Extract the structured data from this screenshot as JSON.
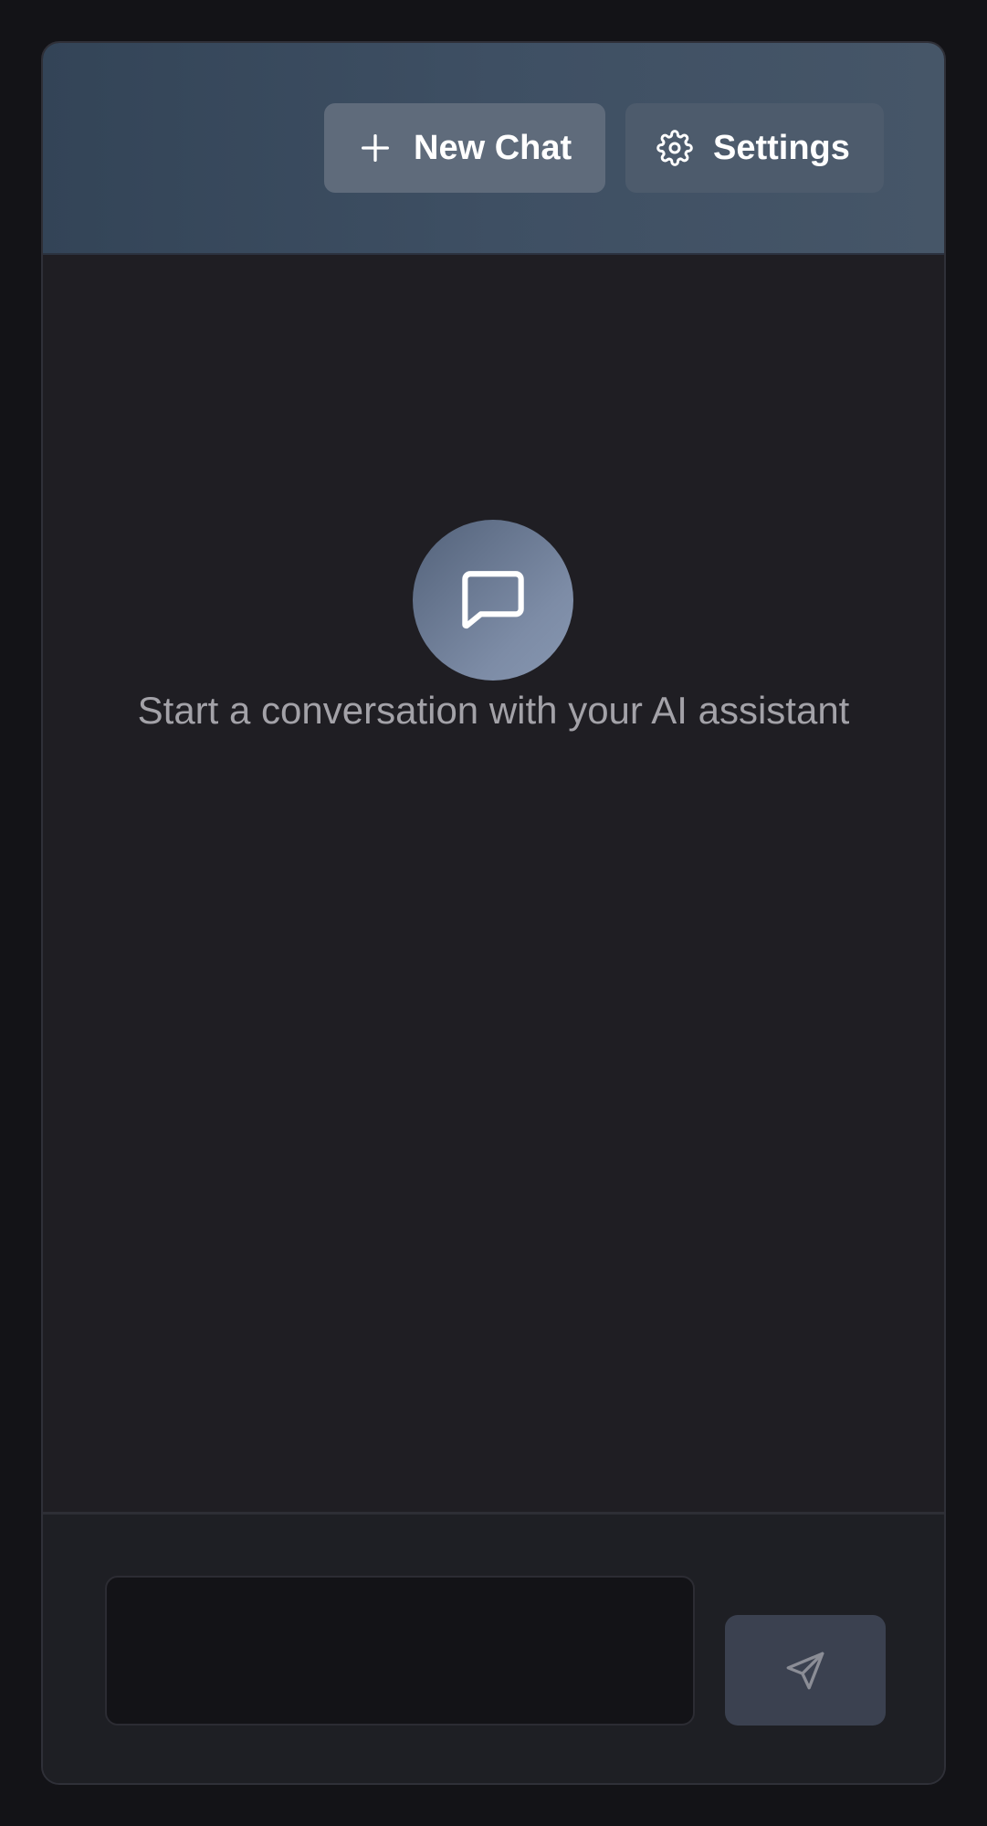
{
  "header": {
    "new_chat_label": "New Chat",
    "new_chat_icon": "plus-icon",
    "settings_label": "Settings",
    "settings_icon": "gear-icon"
  },
  "empty_state": {
    "icon": "chat-bubble-icon",
    "message": "Start a conversation with your AI assistant"
  },
  "composer": {
    "input_value": "",
    "input_placeholder": "",
    "send_icon": "send-icon"
  },
  "colors": {
    "page_background": "#131317",
    "header_gradient_start": "#334457",
    "header_gradient_end": "#465668",
    "new_chat_button": "#5f6b7b",
    "settings_button": "#4d5b6c",
    "panel_background": "#1f1e23",
    "send_button": "#3b4150"
  }
}
